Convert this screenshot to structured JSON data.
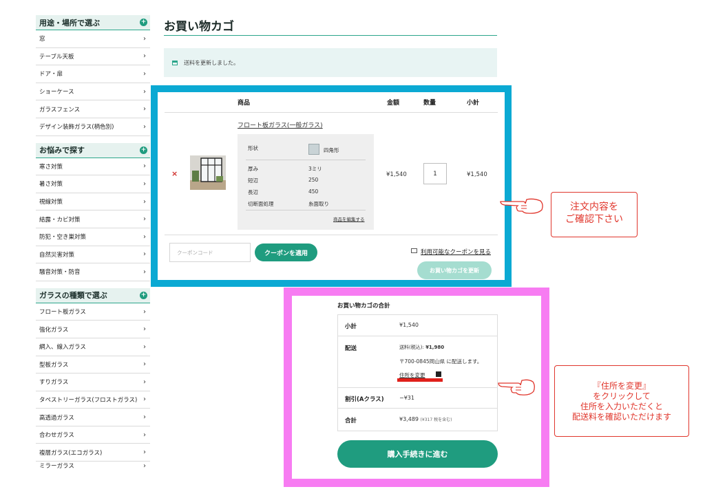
{
  "sidebar": {
    "sections": [
      {
        "title": "用途・場所で選ぶ",
        "items": [
          "窓",
          "テーブル天板",
          "ドア・扉",
          "ショーケース",
          "ガラスフェンス",
          "デザイン装飾ガラス(柄色別)"
        ]
      },
      {
        "title": "お悩みで探す",
        "items": [
          "寒さ対策",
          "暑さ対策",
          "視線対策",
          "結露・カビ対策",
          "防犯・空き巣対策",
          "自然災害対策",
          "騒音対策・防音"
        ]
      },
      {
        "title": "ガラスの種類で選ぶ",
        "items": [
          "フロート板ガラス",
          "強化ガラス",
          "網入、線入ガラス",
          "型板ガラス",
          "すりガラス",
          "タペストリーガラス(フロストガラス)",
          "高透過ガラス",
          "合わせガラス",
          "複層ガラス(エコガラス)",
          "ミラーガラス"
        ]
      }
    ]
  },
  "page": {
    "title": "お買い物カゴ",
    "notice": "送料を更新しました。"
  },
  "cart": {
    "headers": {
      "product": "商品",
      "price": "金額",
      "qty": "数量",
      "subtotal": "小計"
    },
    "remove": "×",
    "product_name": "フロート板ガラス(一般ガラス)",
    "attrs": [
      {
        "label": "形状",
        "value": "四角形"
      },
      {
        "label": "厚み",
        "value": "3ミリ"
      },
      {
        "label": "短辺",
        "value": "250"
      },
      {
        "label": "長辺",
        "value": "450"
      },
      {
        "label": "切断面処理",
        "value": "糸面取り"
      }
    ],
    "edit_link": "商品を編集する",
    "price": "¥1,540",
    "qty": "1",
    "subtotal": "¥1,540",
    "coupon_placeholder": "クーポンコード",
    "apply_coupon": "クーポンを適用",
    "view_coupons": "利用可能なクーポンを見る",
    "update_cart": "お買い物カゴを更新"
  },
  "totals": {
    "heading": "お買い物カゴの合計",
    "subtotal_label": "小計",
    "subtotal_value": "¥1,540",
    "shipping_label": "配送",
    "shipping_fee_label": "送料(税込):",
    "shipping_fee_value": "¥1,980",
    "shipping_dest": "〒700-0845岡山県 に配送します。",
    "change_address": "住所を変更",
    "discount_label": "割引(Aクラス)",
    "discount_value": "−¥31",
    "total_label": "合計",
    "total_value": "¥3,489",
    "total_tax": "(¥317 税を含む)",
    "checkout": "購入手続きに進む"
  },
  "callouts": {
    "order": [
      "注文内容を",
      "ご確認下さい"
    ],
    "address": [
      "『住所を変更』",
      "をクリックして",
      "住所を入力いただくと",
      "配送料を確認いただけます"
    ]
  },
  "colors": {
    "accent": "#1f9c7f",
    "blue_frame": "#0ba9d3",
    "pink_frame": "#f77cf2",
    "callout_red": "#e0352b"
  }
}
